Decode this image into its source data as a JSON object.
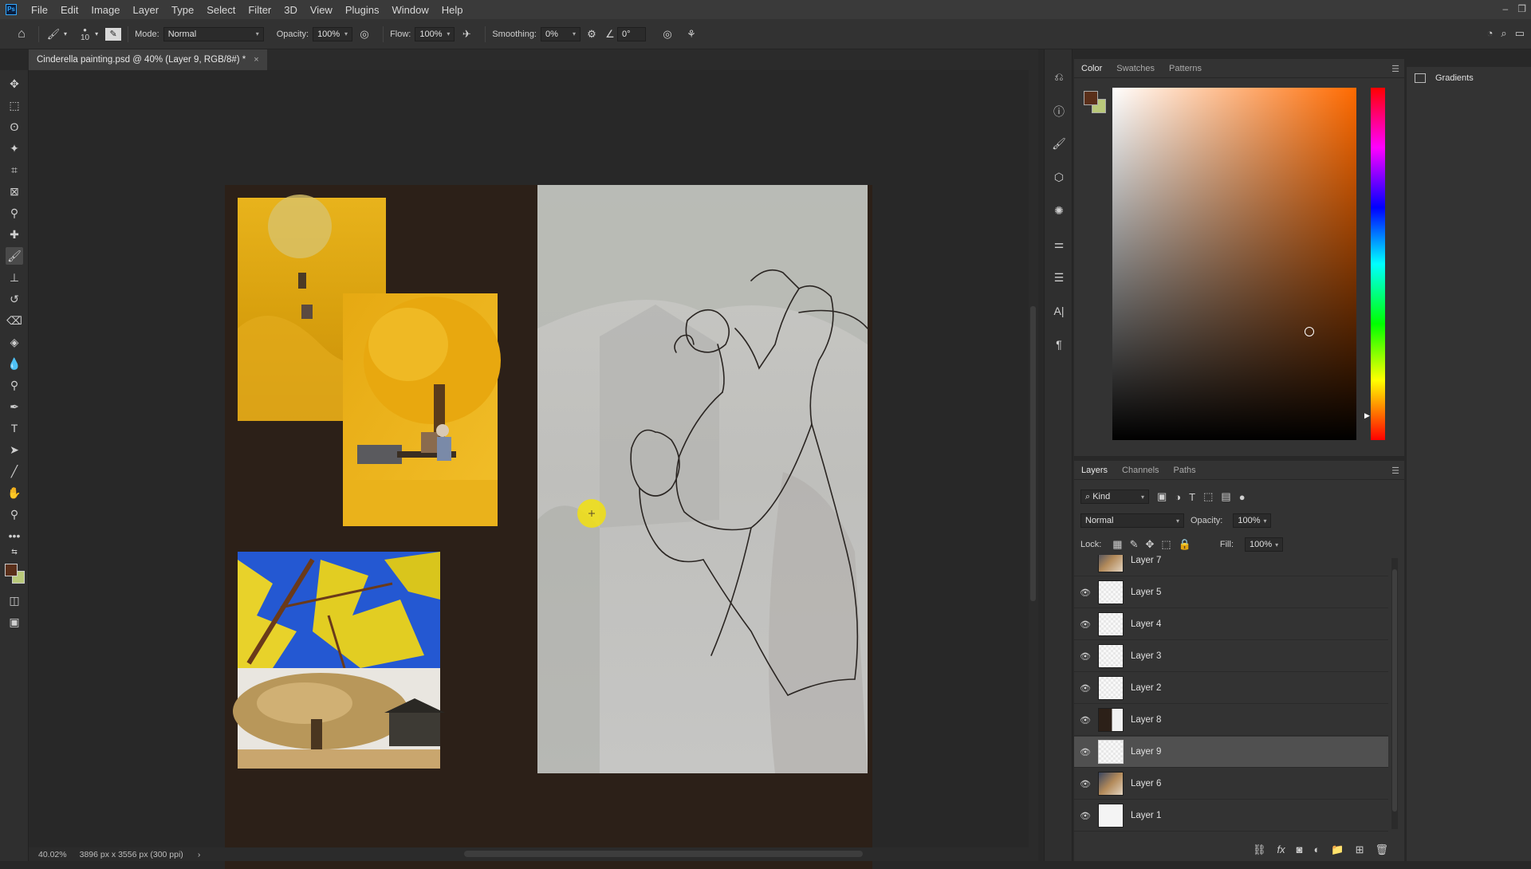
{
  "menubar": {
    "app_icon": "Ps",
    "items": [
      "File",
      "Edit",
      "Image",
      "Layer",
      "Type",
      "Select",
      "Filter",
      "3D",
      "View",
      "Plugins",
      "Window",
      "Help"
    ]
  },
  "options": {
    "brush_size": "10",
    "mode_label": "Mode:",
    "mode_value": "Normal",
    "opacity_label": "Opacity:",
    "opacity_value": "100%",
    "flow_label": "Flow:",
    "flow_value": "100%",
    "smoothing_label": "Smoothing:",
    "smoothing_value": "0%",
    "angle_value": "0°"
  },
  "document": {
    "tab_title": "Cinderella painting.psd @ 40% (Layer 9, RGB/8#) *",
    "tab_close": "×"
  },
  "status": {
    "zoom": "40.02%",
    "doc_info": "3896 px x 3556 px (300 ppi)",
    "arrow": "›"
  },
  "color_panel": {
    "tabs": [
      "Color",
      "Swatches",
      "Patterns"
    ],
    "foreground_color": "#5a2f1a",
    "background_color": "#b9c97a",
    "hue_color": "#ff6a00"
  },
  "gradients_panel": {
    "title": "Gradients"
  },
  "layers_panel": {
    "tabs": [
      "Layers",
      "Channels",
      "Paths"
    ],
    "filter_kind": "Kind",
    "blend_mode": "Normal",
    "opacity_label": "Opacity:",
    "opacity_value": "100%",
    "lock_label": "Lock:",
    "fill_label": "Fill:",
    "fill_value": "100%",
    "layers": [
      {
        "name": "Layer 7",
        "visible": false,
        "selected": false,
        "thumb": "photo"
      },
      {
        "name": "Layer 5",
        "visible": true,
        "selected": false,
        "thumb": "light"
      },
      {
        "name": "Layer 4",
        "visible": true,
        "selected": false,
        "thumb": "light"
      },
      {
        "name": "Layer 3",
        "visible": true,
        "selected": false,
        "thumb": "light"
      },
      {
        "name": "Layer 2",
        "visible": true,
        "selected": false,
        "thumb": "light"
      },
      {
        "name": "Layer 8",
        "visible": true,
        "selected": false,
        "thumb": "dark"
      },
      {
        "name": "Layer 9",
        "visible": true,
        "selected": true,
        "thumb": "light"
      },
      {
        "name": "Layer 6",
        "visible": true,
        "selected": false,
        "thumb": "photo"
      },
      {
        "name": "Layer 1",
        "visible": true,
        "selected": false,
        "thumb": "white"
      }
    ]
  }
}
